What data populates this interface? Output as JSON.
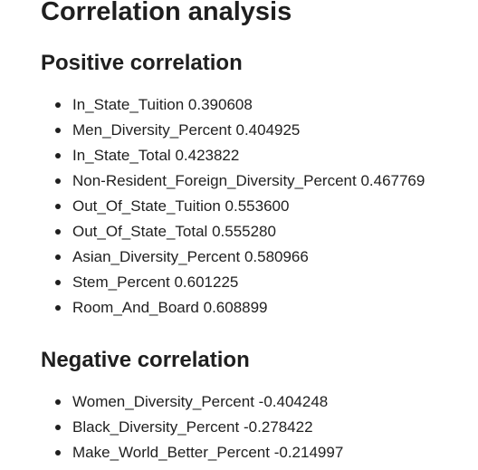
{
  "page_title": "Correlation analysis",
  "positive": {
    "heading": "Positive correlation",
    "items": [
      {
        "name": "In_State_Tuition",
        "value": "0.390608"
      },
      {
        "name": "Men_Diversity_Percent",
        "value": "0.404925"
      },
      {
        "name": "In_State_Total",
        "value": "0.423822"
      },
      {
        "name": "Non-Resident_Foreign_Diversity_Percent",
        "value": "0.467769"
      },
      {
        "name": "Out_Of_State_Tuition",
        "value": "0.553600"
      },
      {
        "name": "Out_Of_State_Total",
        "value": "0.555280"
      },
      {
        "name": "Asian_Diversity_Percent",
        "value": "0.580966"
      },
      {
        "name": "Stem_Percent",
        "value": "0.601225"
      },
      {
        "name": "Room_And_Board",
        "value": "0.608899"
      }
    ]
  },
  "negative": {
    "heading": "Negative correlation",
    "items": [
      {
        "name": "Women_Diversity_Percent",
        "value": "-0.404248"
      },
      {
        "name": "Black_Diversity_Percent",
        "value": "-0.278422"
      },
      {
        "name": "Make_World_Better_Percent",
        "value": "-0.214997"
      }
    ]
  }
}
